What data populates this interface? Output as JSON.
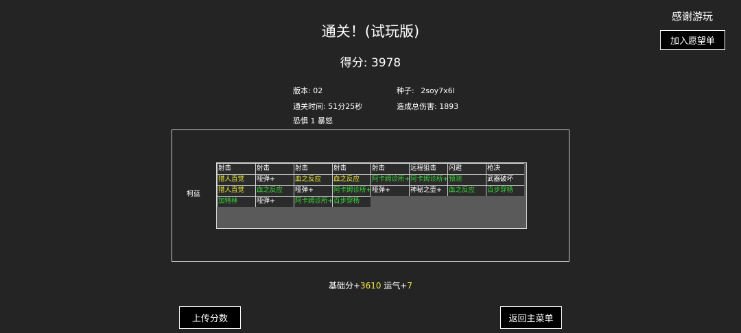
{
  "title": "通关！(试玩版)",
  "score": {
    "label": "得分:",
    "value": "3978"
  },
  "thanks": "感谢游玩",
  "buttons": {
    "wishlist": "加入愿望单",
    "upload": "上传分数",
    "main_menu": "返回主菜单"
  },
  "stats": {
    "version": "版本:  02",
    "seed_label": "种子:",
    "seed_value": "2soy7x6l",
    "clear_time": "通关时间:  51分25秒",
    "total_damage": "造成总伤害:  1893",
    "modifier": "恐惧  1  暴怒"
  },
  "character": "柯蓝",
  "colors": {
    "white": "#ffffff",
    "yellow": "#e8e83a",
    "green": "#3ad83a",
    "highlight": "#f2e84a"
  },
  "cards": [
    [
      {
        "text": "射击",
        "color": "white"
      },
      {
        "text": "射击",
        "color": "white"
      },
      {
        "text": "射击",
        "color": "white"
      },
      {
        "text": "射击",
        "color": "white"
      },
      {
        "text": "射击",
        "color": "white"
      },
      {
        "text": "远程狙击",
        "color": "white"
      },
      {
        "text": "闪避",
        "color": "white"
      },
      {
        "text": "枪决",
        "color": "white"
      }
    ],
    [
      {
        "text": "猎人直觉",
        "color": "yellow"
      },
      {
        "text": "哑弹+",
        "color": "white"
      },
      {
        "text": "血之反应",
        "color": "yellow"
      },
      {
        "text": "血之反应",
        "color": "yellow"
      },
      {
        "text": "阿卡姆诊所+",
        "color": "green"
      },
      {
        "text": "阿卡姆诊所+",
        "color": "green"
      },
      {
        "text": "预测",
        "color": "green"
      },
      {
        "text": "武器破坏",
        "color": "white"
      }
    ],
    [
      {
        "text": "猎人直觉",
        "color": "yellow"
      },
      {
        "text": "血之反应",
        "color": "green"
      },
      {
        "text": "哑弹+",
        "color": "white"
      },
      {
        "text": "阿卡姆诊所+",
        "color": "green"
      },
      {
        "text": "哑弹+",
        "color": "white"
      },
      {
        "text": "神秘之壶+",
        "color": "white"
      },
      {
        "text": "血之反应",
        "color": "green"
      },
      {
        "text": "百步穿杨",
        "color": "green"
      }
    ],
    [
      {
        "text": "加特林",
        "color": "green"
      },
      {
        "text": "哑弹+",
        "color": "white"
      },
      {
        "text": "阿卡姆诊所+",
        "color": "green"
      },
      {
        "text": "百步穿杨",
        "color": "green"
      }
    ]
  ],
  "summary": {
    "base_label": "基础分+",
    "base_value": "3610",
    "luck_label": " 运气+",
    "luck_value": "7"
  }
}
